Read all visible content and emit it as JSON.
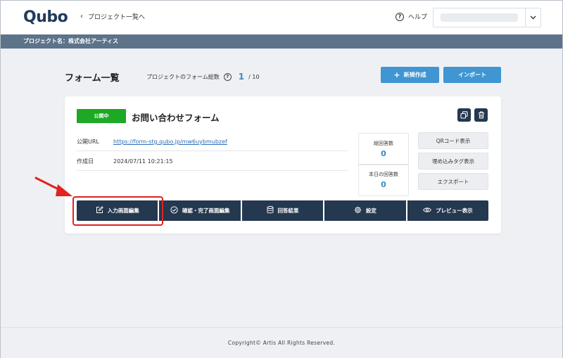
{
  "app": {
    "logo": "Qubo",
    "back_label": "プロジェクト一覧へ",
    "help_label": "ヘルプ"
  },
  "project_bar": {
    "label": "プロジェクト名：株式会社アーティス"
  },
  "page": {
    "title": "フォーム一覧",
    "count_label": "プロジェクトのフォーム総数",
    "count_value": "1",
    "count_total": "/ 10",
    "new_button": "新規作成",
    "import_button": "インポート"
  },
  "form": {
    "status": "公開中",
    "status_color": "#1da826",
    "title": "お問い合わせフォーム",
    "url_label": "公開URL",
    "url_value": "https://form-stg.qubo.jp/mw6uybmubzef",
    "created_label": "作成日",
    "created_value": "2024/07/11 10:21:15",
    "stats": [
      {
        "label": "総回答数",
        "value": "0"
      },
      {
        "label": "本日の回答数",
        "value": "0"
      }
    ],
    "side_buttons": [
      "QRコード表示",
      "埋め込みタグ表示",
      "エクスポート"
    ],
    "actions": [
      {
        "label": "入力画面編集",
        "icon": "edit-icon"
      },
      {
        "label": "確認・完了画面編集",
        "icon": "check-circle-icon"
      },
      {
        "label": "回答結果",
        "icon": "database-icon"
      },
      {
        "label": "設定",
        "icon": "gear-icon"
      },
      {
        "label": "プレビュー表示",
        "icon": "eye-icon"
      }
    ]
  },
  "footer": {
    "copyright": "Copyright© Artis All Rights Reserved."
  },
  "colors": {
    "navy": "#24384f",
    "accent_blue": "#3f96d2",
    "highlight_red": "#e0231f"
  }
}
